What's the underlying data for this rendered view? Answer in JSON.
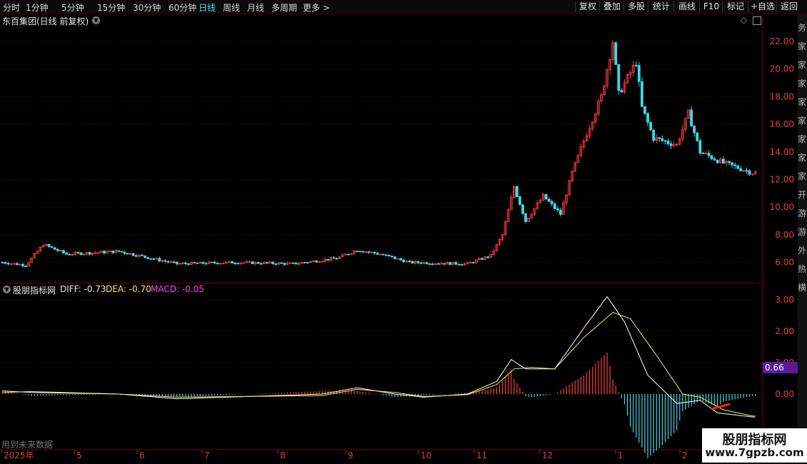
{
  "toolbar": {
    "periods": [
      "分时",
      "1分钟",
      "5分钟",
      "15分钟",
      "30分钟",
      "60分钟",
      "日线",
      "周线",
      "月线",
      "多周期",
      "更多 >"
    ],
    "active_period": "日线",
    "right_buttons": [
      "复权",
      "叠加",
      "多股",
      "统计",
      "画线",
      "F10",
      "标记",
      "+自选",
      "返回"
    ]
  },
  "stock_title": "东百集团(日线 前复权)",
  "indicator": {
    "name": "股朋指标网",
    "diff_label": "DIFF: -0.73",
    "dea_label": "DEA: -0.70",
    "macd_label": "MACD: -0.05",
    "current_value": "0.66"
  },
  "price_axis": [
    "22.00",
    "20.00",
    "18.00",
    "16.00",
    "14.00",
    "12.00",
    "10.00",
    "8.00",
    "6.00"
  ],
  "macd_axis": [
    "3.00",
    "2.00",
    "1.00",
    "0.00"
  ],
  "date_axis": [
    "2025年",
    "5",
    "6",
    "7",
    "8",
    "9",
    "10",
    "11",
    "12",
    "1",
    "2"
  ],
  "footer_note": "用到未来数据",
  "watermark": {
    "name": "股朋指标网",
    "url": "www.7gpzb.com"
  },
  "side_strip": "务家家家家家家家家开游游外热横",
  "colors": {
    "up": "#ff3c3c",
    "down": "#42d8e8",
    "diff": "#ffffff",
    "dea": "#f3f050",
    "macd": "#ff40ff",
    "grid": "#4a0000"
  }
}
